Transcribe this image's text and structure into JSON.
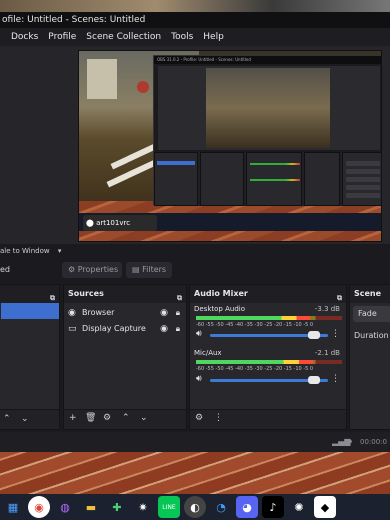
{
  "window": {
    "title": "ofile: Untitled - Scenes: Untitled"
  },
  "menu": [
    "Docks",
    "Profile",
    "Scene Collection",
    "Tools",
    "Help"
  ],
  "preview": {
    "avatar_name": "art101vrc",
    "inner_title": "OBS 31.0.2 - Profile: Untitled - Scenes: Untitled"
  },
  "under_preview": {
    "scale_label": "ale to Window",
    "edge_label": "ed"
  },
  "filter_tabs": {
    "properties": "Properties",
    "filters": "Filters"
  },
  "sources": {
    "title": "Sources",
    "items": [
      {
        "label": "Browser",
        "icon": "globe-icon",
        "visible": true,
        "locked": false
      },
      {
        "label": "Display Capture",
        "icon": "monitor-icon",
        "visible": true,
        "locked": false
      }
    ]
  },
  "audio_mixer": {
    "title": "Audio Mixer",
    "channels": [
      {
        "name": "Desktop Audio",
        "db": "-3.3 dB",
        "level": 0.78,
        "volume": 0.93
      },
      {
        "name": "Mic/Aux",
        "db": "-2.1 dB",
        "level": 0.8,
        "volume": 0.93
      }
    ],
    "scale": "-60 -55 -50 -45 -40 -35 -30 -25 -20 -15 -10 -5 0"
  },
  "scene_transitions": {
    "title": "Scene Tra",
    "transition": "Fade",
    "duration_label": "Duration"
  },
  "status": {
    "time": "00:00:0"
  },
  "colors": {
    "accent": "#3d7cd6",
    "meter_green": "#4fd85d",
    "meter_yellow": "#ffd23a",
    "meter_red": "#ff4a3a"
  },
  "taskbar_icons": [
    "windows-icon",
    "chrome-icon",
    "messenger-icon",
    "folder-icon",
    "app-icon",
    "settings-icon",
    "line-icon",
    "obs-icon",
    "app-icon",
    "discord-icon",
    "tiktok-icon",
    "chatgpt-icon",
    "roblox-icon"
  ]
}
